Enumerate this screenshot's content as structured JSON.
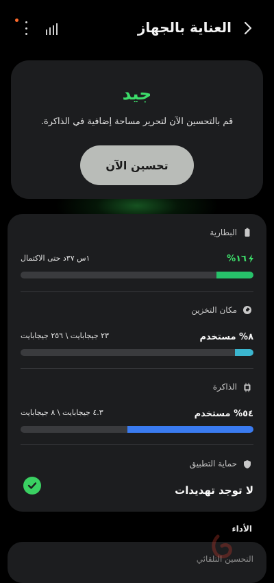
{
  "header": {
    "title": "العناية بالجهاز",
    "icons": {
      "back": "chevron-right-icon",
      "menu": "more-vertical-icon",
      "signal": "signal-bars-icon"
    },
    "notification_dot_color": "#ff6a2b"
  },
  "status": {
    "title": "جيد",
    "description": "قم بالتحسين الآن لتحرير مساحة إضافية في الذاكرة.",
    "button_label": "تحسين الآن",
    "accent": "#3ddc6a"
  },
  "battery": {
    "label": "البطارية",
    "percent": "١٦%",
    "time_left": "١س ٣٧د حتى الاكتمال",
    "level": 0.16,
    "bar_color": "#27c26a"
  },
  "storage": {
    "label": "مكان التخزين",
    "used": "٨% مستخدم",
    "amount": "٢٣ جيجابايت \\ ٢٥٦ جيجابايت",
    "level": 0.08,
    "bar_color": "#3bb6cf"
  },
  "memory": {
    "label": "الذاكرة",
    "used": "٥٤% مستخدم",
    "amount": "٤.٣ جيجابايت \\ ٨ جيجابايت",
    "level": 0.54,
    "bar_color": "#3a7bf0"
  },
  "app_protection": {
    "label": "حماية التطبيق",
    "status": "لا توجد تهديدات",
    "icon": "check-circle-icon",
    "icon_color": "#3ad062"
  },
  "performance": {
    "label": "الأداء",
    "first_item": "التحسين التلقائي"
  }
}
